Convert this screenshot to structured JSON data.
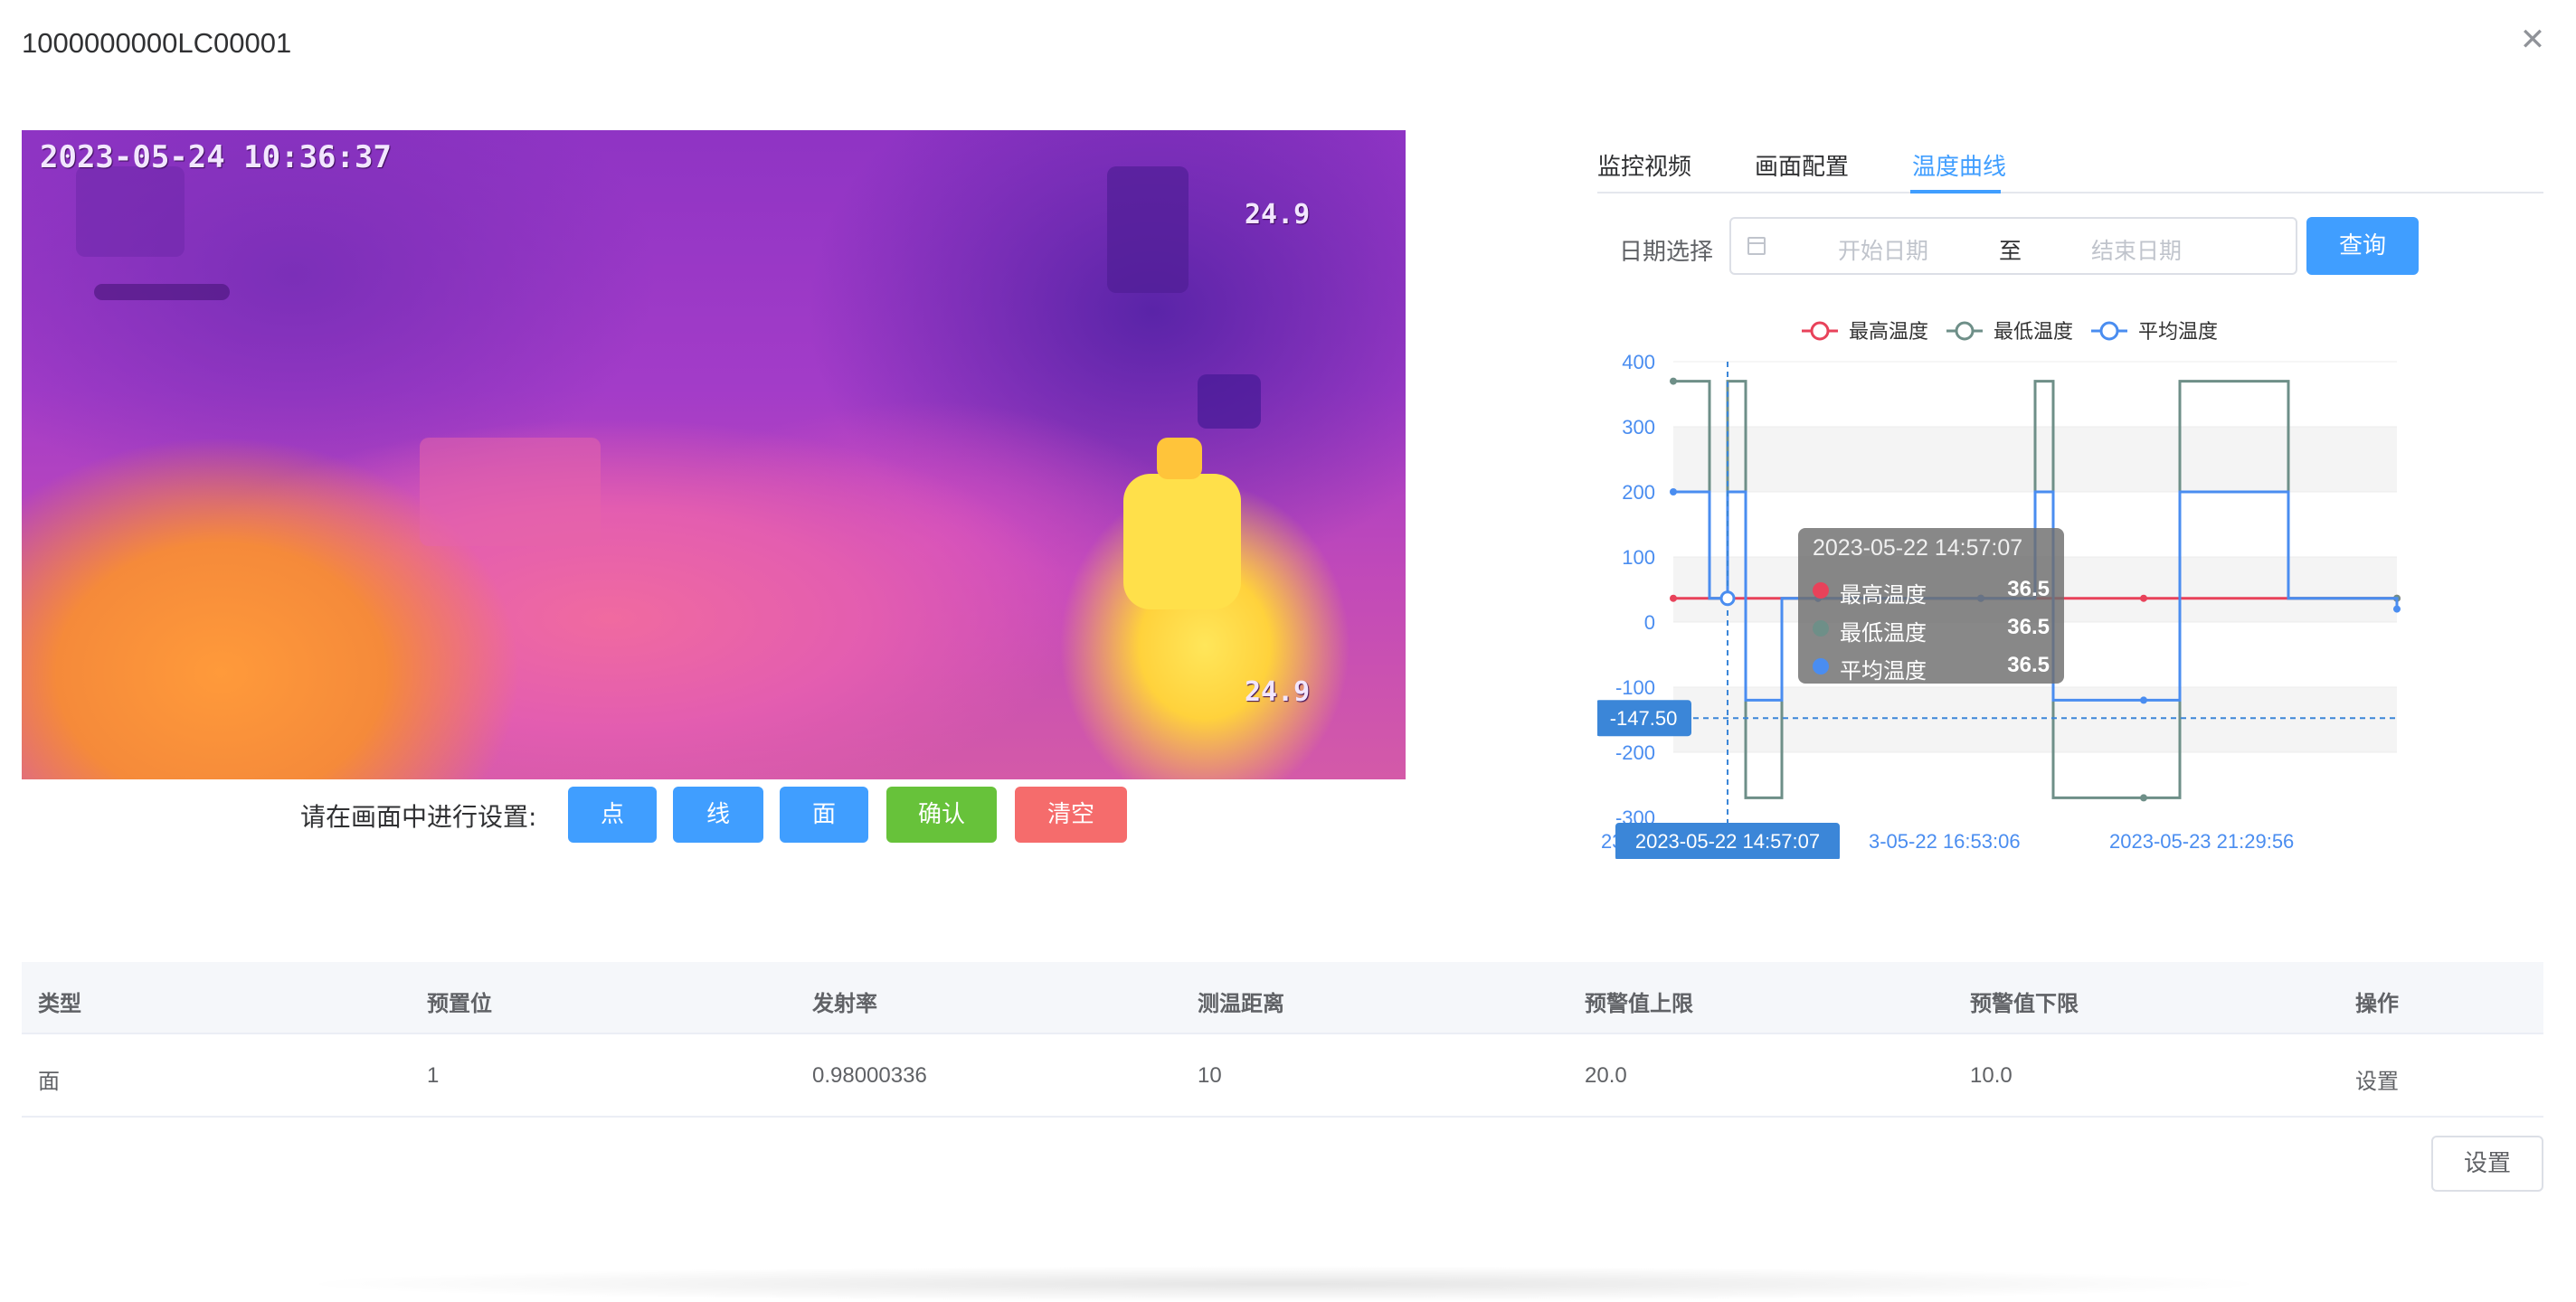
{
  "dialog": {
    "title": "1000000000LC00001",
    "close_icon": "close-icon"
  },
  "video": {
    "timestamp": "2023-05-24 10:36:37",
    "temp_top": "24.9",
    "temp_bottom": "24.9"
  },
  "setup": {
    "label": "请在画面中进行设置:",
    "point_label": "点",
    "line_label": "线",
    "area_label": "面",
    "confirm_label": "确认",
    "clear_label": "清空"
  },
  "tabs": [
    {
      "label": "监控视频",
      "active": false
    },
    {
      "label": "画面配置",
      "active": false
    },
    {
      "label": "温度曲线",
      "active": true
    }
  ],
  "date_filter": {
    "label": "日期选择",
    "start_placeholder": "开始日期",
    "separator": "至",
    "end_placeholder": "结束日期",
    "query_label": "查询"
  },
  "chart_data": {
    "type": "line",
    "step": true,
    "legend": [
      "最高温度",
      "最低温度",
      "平均温度"
    ],
    "legend_position": "top",
    "colors": {
      "最高温度": "#e8425a",
      "最低温度": "#6e8f88",
      "平均温度": "#4a8df0"
    },
    "ylim": [
      -300,
      400
    ],
    "yticks": [
      400,
      300,
      200,
      100,
      0,
      -100,
      -200,
      -300
    ],
    "xtick_labels": [
      "2023-05-22 14:57:07",
      "2023-05-22 16:53:06",
      "2023-05-23 21:29:56"
    ],
    "x": [
      0,
      1,
      2,
      3,
      4,
      5,
      6,
      7,
      8,
      9,
      10,
      11,
      12,
      13,
      14,
      15,
      16,
      17,
      18,
      19,
      20,
      21,
      22,
      23,
      24,
      25,
      26,
      27,
      28,
      29,
      30,
      31,
      32,
      33,
      34,
      35,
      36,
      37,
      38,
      39,
      40
    ],
    "series": [
      {
        "name": "最高温度",
        "values": [
          36.5,
          36.5,
          36.5,
          36.5,
          36.5,
          36.5,
          36.5,
          36.5,
          36.5,
          36.5,
          36.5,
          36.5,
          36.5,
          36.5,
          36.5,
          36.5,
          36.5,
          36.5,
          36.5,
          36.5,
          36.5,
          36.5,
          36.5,
          36.5,
          36.5,
          36.5,
          36.5,
          36.5,
          36.5,
          36.5,
          36.5,
          36.5,
          36.5,
          36.5,
          36.5,
          36.5,
          36.5,
          36.5,
          36.5,
          36.5,
          36.5
        ]
      },
      {
        "name": "最低温度",
        "values": [
          370,
          370,
          36.5,
          370,
          -270,
          -270,
          36.5,
          36.5,
          36.5,
          36.5,
          36.5,
          36.5,
          36.5,
          36.5,
          36.5,
          36.5,
          36.5,
          36.5,
          36.5,
          36.5,
          370,
          -270,
          -270,
          -270,
          -270,
          -270,
          -270,
          -270,
          370,
          370,
          370,
          370,
          370,
          370,
          36.5,
          36.5,
          36.5,
          36.5,
          36.5,
          36.5,
          36.5
        ]
      },
      {
        "name": "平均温度",
        "values": [
          200,
          200,
          36.5,
          200,
          -120,
          -120,
          36.5,
          36.5,
          36.5,
          36.5,
          36.5,
          36.5,
          36.5,
          36.5,
          36.5,
          36.5,
          36.5,
          36.5,
          36.5,
          36.5,
          200,
          -120,
          -120,
          -120,
          -120,
          -120,
          -120,
          -120,
          200,
          200,
          200,
          200,
          200,
          200,
          36.5,
          36.5,
          36.5,
          36.5,
          36.5,
          36.5,
          20
        ]
      }
    ],
    "crosshair": {
      "x_label": "2023-05-22 14:57:07",
      "y_label": "-147.50"
    },
    "tooltip": {
      "title": "2023-05-22 14:57:07",
      "rows": [
        {
          "name": "最高温度",
          "value": "36.5"
        },
        {
          "name": "最低温度",
          "value": "36.5"
        },
        {
          "name": "平均温度",
          "value": "36.5"
        }
      ]
    },
    "x_edge_labels": {
      "left": "23-05",
      "mid": "3-05-22 16:53:06",
      "right": "2023-05-23 21:29:56"
    },
    "grid": "horizontal bands"
  },
  "table": {
    "headers": [
      "类型",
      "预置位",
      "发射率",
      "测温距离",
      "预警值上限",
      "预警值下限",
      "操作"
    ],
    "rows": [
      {
        "type": "面",
        "preset": "1",
        "emissivity": "0.98000336",
        "distance": "10",
        "upper": "20.0",
        "lower": "10.0",
        "action": "设置"
      }
    ]
  },
  "footer": {
    "set_label": "设置"
  }
}
